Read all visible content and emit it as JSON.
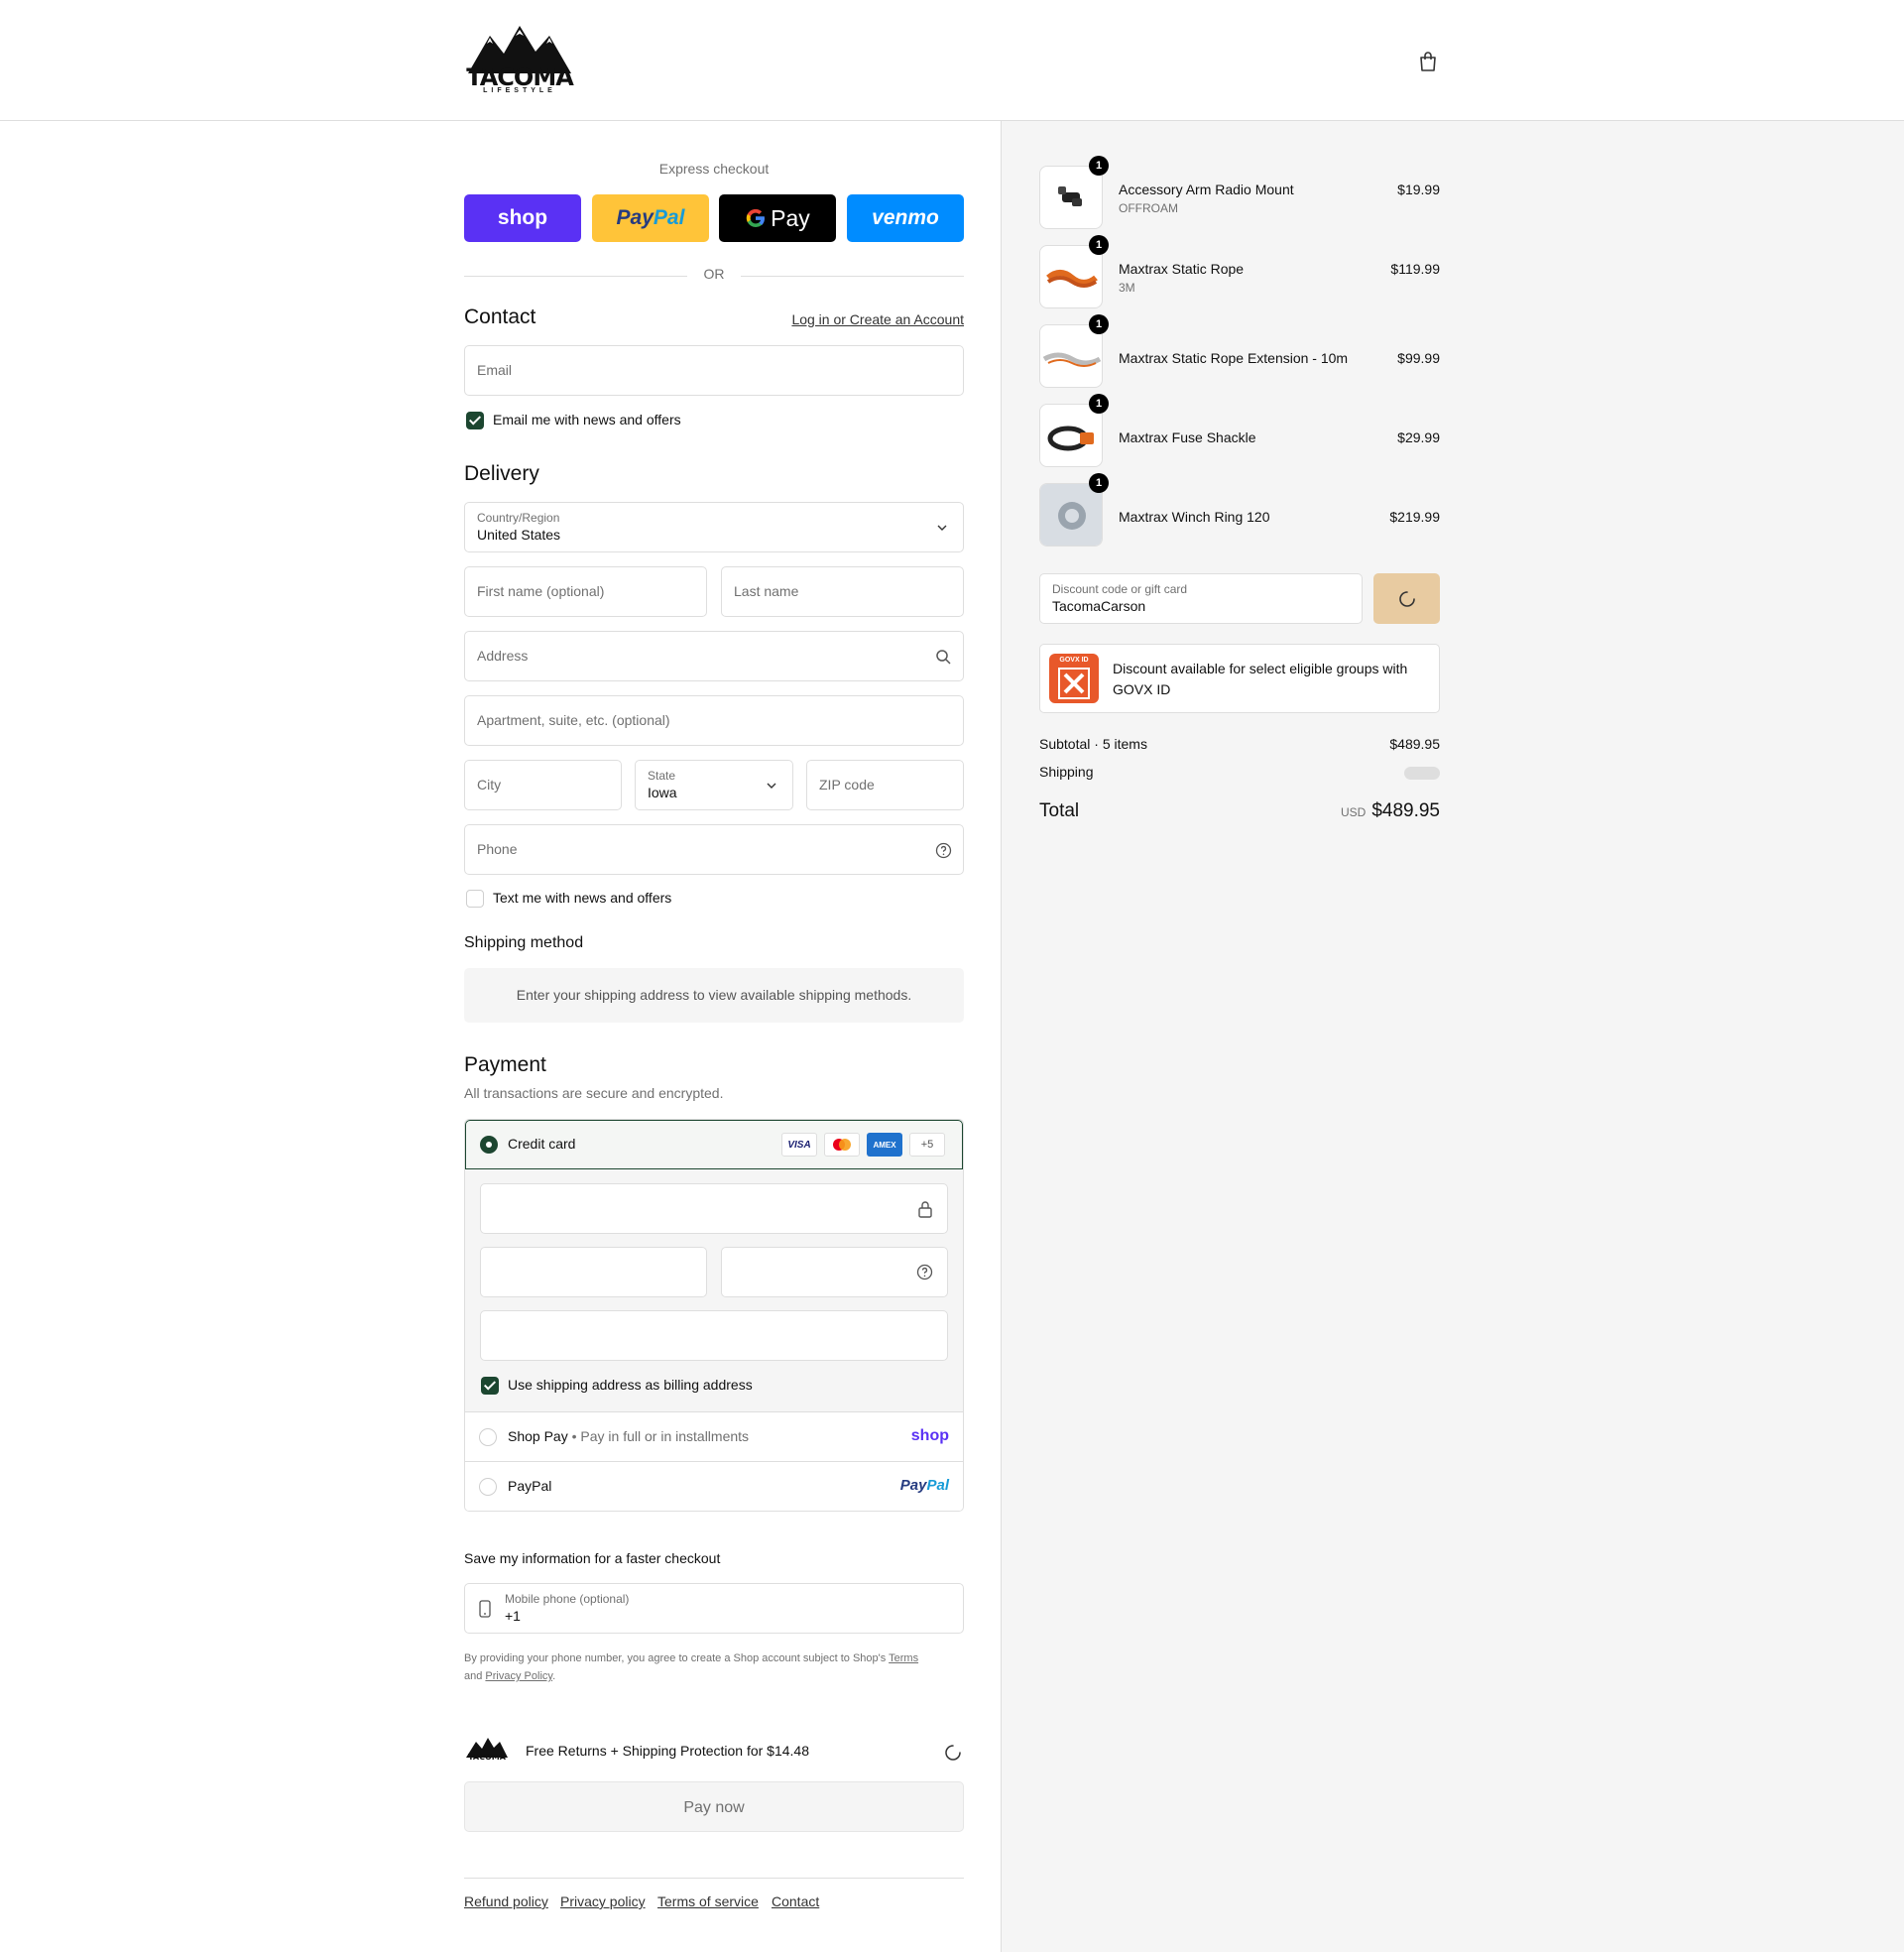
{
  "brand": {
    "logo_text": "TACOMA",
    "logo_sub": "LIFESTYLE"
  },
  "express": {
    "label": "Express checkout",
    "buttons": {
      "shop": "shop",
      "paypal_1": "Pay",
      "paypal_2": "Pal",
      "gpay": "Pay",
      "venmo": "venmo"
    },
    "or": "OR"
  },
  "contact": {
    "title": "Contact",
    "login_link": "Log in or Create an Account",
    "email_placeholder": "Email",
    "news_checkbox": "Email me with news and offers"
  },
  "delivery": {
    "title": "Delivery",
    "country_label": "Country/Region",
    "country_value": "United States",
    "first_name": "First name (optional)",
    "last_name": "Last name",
    "address": "Address",
    "apartment": "Apartment, suite, etc. (optional)",
    "city": "City",
    "state_label": "State",
    "state_value": "Iowa",
    "zip": "ZIP code",
    "phone": "Phone",
    "text_checkbox": "Text me with news and offers"
  },
  "shipping_method": {
    "title": "Shipping method",
    "note": "Enter your shipping address to view available shipping methods."
  },
  "payment": {
    "title": "Payment",
    "subtitle": "All transactions are secure and encrypted.",
    "credit_card": "Credit card",
    "cards": {
      "visa": "VISA",
      "amex": "AMEX",
      "more": "+5"
    },
    "billing_checkbox": "Use shipping address as billing address",
    "shop_pay": "Shop Pay",
    "shop_pay_note": "Pay in full or in installments",
    "shop_pay_logo": "shop",
    "paypal": "PayPal",
    "paypal_logo_1": "Pay",
    "paypal_logo_2": "Pal"
  },
  "save_info": {
    "title": "Save my information for a faster checkout",
    "mobile_label": "Mobile phone (optional)",
    "mobile_value": "+1",
    "consent_1": "By providing your phone number, you agree to create a Shop account subject to Shop's",
    "terms": "Terms",
    "consent_and": "and",
    "privacy": "Privacy Policy",
    "consent_end": "."
  },
  "protection": {
    "text": "Free Returns + Shipping Protection for $14.48"
  },
  "pay_now": "Pay now",
  "footer": {
    "refund": "Refund policy",
    "privacy": "Privacy policy",
    "terms": "Terms of service",
    "contact": "Contact"
  },
  "cart": {
    "items": [
      {
        "qty": "1",
        "name": "Accessory Arm Radio Mount",
        "variant": "OFFROAM",
        "price": "$19.99"
      },
      {
        "qty": "1",
        "name": "Maxtrax Static Rope",
        "variant": "3M",
        "price": "$119.99"
      },
      {
        "qty": "1",
        "name": "Maxtrax Static Rope Extension - 10m",
        "variant": "",
        "price": "$99.99"
      },
      {
        "qty": "1",
        "name": "Maxtrax Fuse Shackle",
        "variant": "",
        "price": "$29.99"
      },
      {
        "qty": "1",
        "name": "Maxtrax Winch Ring 120",
        "variant": "",
        "price": "$219.99"
      }
    ],
    "discount_label": "Discount code or gift card",
    "discount_value": "TacomaCarson",
    "govx_text": "Discount available for select eligible groups with GOVX ID",
    "govx_badge": "GOVX ID",
    "subtotal_label": "Subtotal · 5 items",
    "subtotal_value": "$489.95",
    "shipping_label": "Shipping",
    "total_label": "Total",
    "currency": "USD",
    "total_value": "$489.95"
  },
  "colors": {
    "accent": "#1c4630",
    "shop": "#5a31f4",
    "paypal": "#ffc439",
    "venmo": "#008cff",
    "discount_btn": "#e8cba1"
  }
}
